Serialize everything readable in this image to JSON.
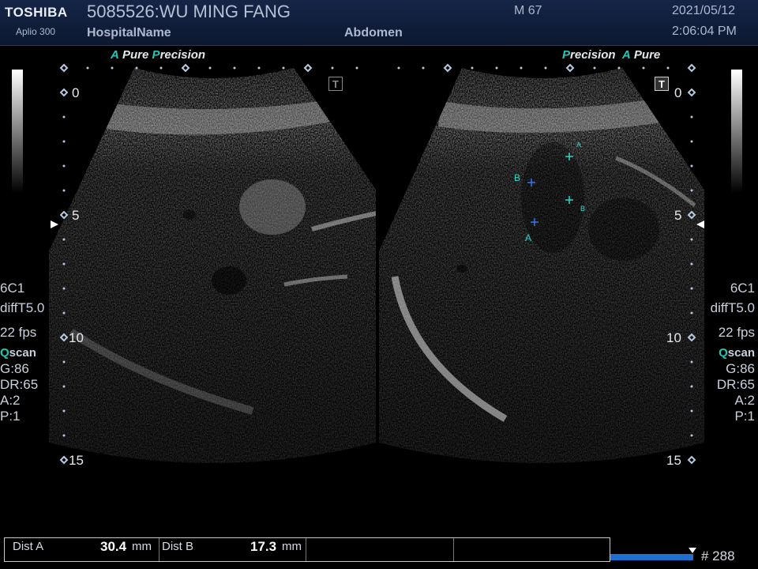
{
  "header": {
    "brand": "TOSHIBA",
    "model": "Aplio 300",
    "patient": "5085526:WU MING FANG",
    "hospital": "HospitalName",
    "exam": "Abdomen",
    "mi": "M 67",
    "date": "2021/05/12",
    "time": "2:06:04 PM"
  },
  "left_image": {
    "mode_a": "A",
    "mode_pure": "Pure",
    "mode_p": "P",
    "mode_recision": "recision",
    "tbox": "T",
    "scale": [
      "0",
      "5",
      "10",
      "15"
    ]
  },
  "right_image": {
    "mode_p": "P",
    "mode_recision": "recision",
    "mode_a": "A",
    "mode_pure": "Pure",
    "tbox": "T",
    "scale": [
      "0",
      "5",
      "10",
      "15"
    ],
    "marker_a": "A",
    "marker_b": "B"
  },
  "side_panel": {
    "probe": "6C1",
    "preset": "diffT5.0",
    "fps": "22 fps",
    "qscan_q": "Q",
    "qscan_rest": "scan",
    "gain": "G:86",
    "dr": "DR:65",
    "a": "A:2",
    "p": "P:1"
  },
  "measurements": {
    "dist_a_label": "Dist A",
    "dist_a_value": "30.4",
    "dist_a_unit": "mm",
    "dist_b_label": "Dist B",
    "dist_b_value": "17.3",
    "dist_b_unit": "mm"
  },
  "cine": {
    "frame": "# 288"
  }
}
